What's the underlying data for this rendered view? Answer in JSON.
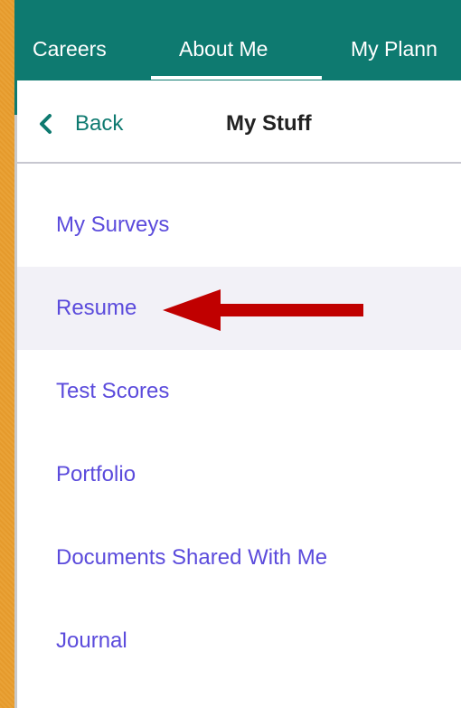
{
  "nav": {
    "tabs": [
      {
        "label": "Careers"
      },
      {
        "label": "About Me"
      },
      {
        "label": "My Plann"
      }
    ]
  },
  "panel": {
    "back_label": "Back",
    "title": "My Stuff",
    "items": [
      {
        "label": "My Surveys"
      },
      {
        "label": "Resume"
      },
      {
        "label": "Test Scores"
      },
      {
        "label": "Portfolio"
      },
      {
        "label": "Documents Shared With Me"
      },
      {
        "label": "Journal"
      }
    ]
  },
  "colors": {
    "nav_background": "#0e7a70",
    "link_text": "#5b4bdc",
    "annotation_arrow": "#c00000",
    "page_background": "#e9a237"
  },
  "annotation": {
    "icon": "left-arrow-icon",
    "points_to": "Resume"
  }
}
